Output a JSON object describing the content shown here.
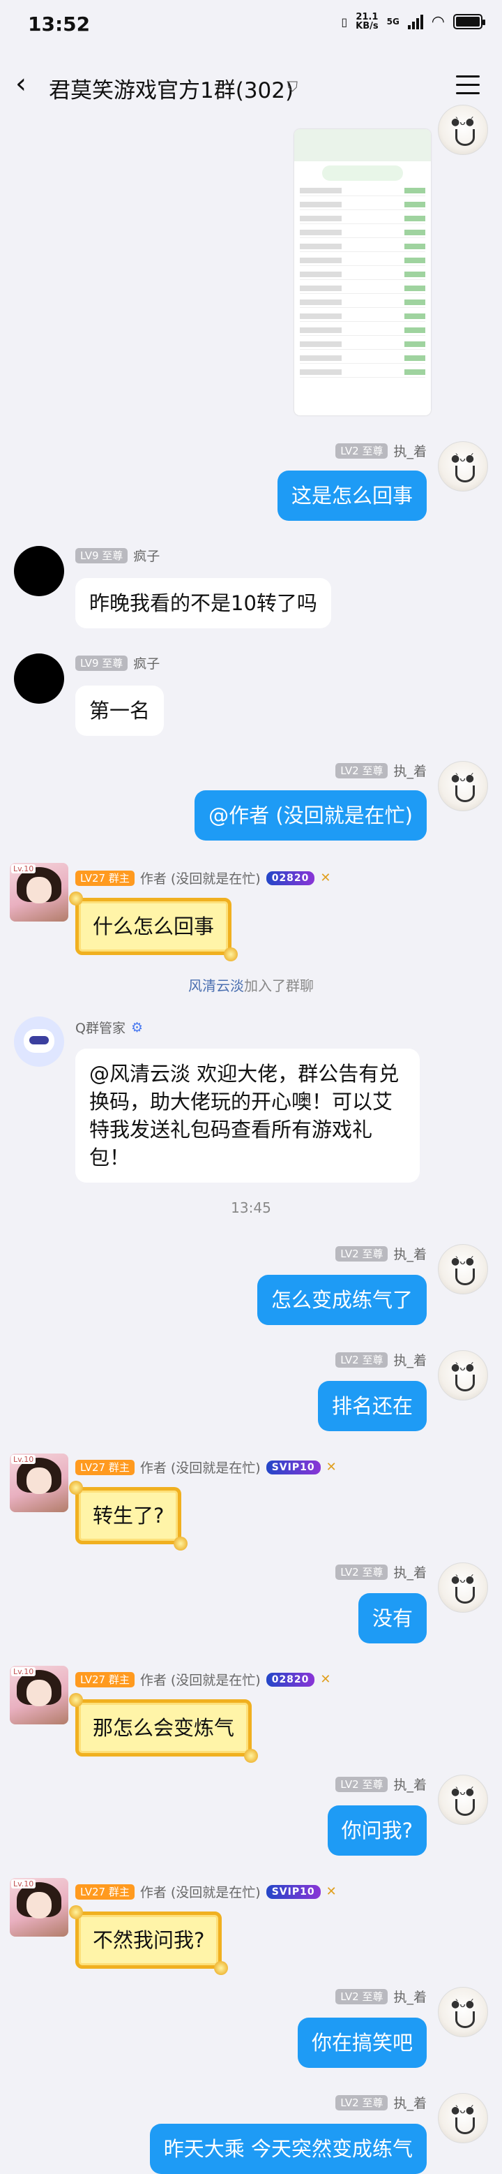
{
  "status": {
    "time": "13:52",
    "net_speed": "21.1",
    "net_unit": "KB/s",
    "net_type": "5G"
  },
  "header": {
    "title": "君莫笑游戏官方1群(302)"
  },
  "users": {
    "self": {
      "level": "LV2 至尊",
      "name": "执_着"
    },
    "fengzi": {
      "level": "LV9 至尊",
      "name": "疯子"
    },
    "author": {
      "level": "LV27 群主",
      "name": "作者 (没回就是在忙)",
      "vip": "SVIP10",
      "avatar_level": "Lv.10"
    },
    "author2": {
      "vip": "02820"
    },
    "bot": {
      "name": "Q群管家"
    }
  },
  "messages": {
    "m1": "这是怎么回事",
    "m2": "昨晚我看的不是10转了吗",
    "m3": "第一名",
    "m4": "@作者 (没回就是在忙)",
    "m5": "什么怎么回事",
    "join_name": "风清云淡",
    "join_suffix": "加入了群聊",
    "m6": "@风清云淡 欢迎大佬，群公告有兑换码，助大佬玩的开心噢！可以艾特我发送礼包码查看所有游戏礼包！",
    "time_divider": "13:45",
    "m7": "怎么变成练气了",
    "m8": "排名还在",
    "m9": "转生了?",
    "m10": "没有",
    "m11": "那怎么会变炼气",
    "m12": "你问我?",
    "m13": "不然我问我?",
    "m14": "你在搞笑吧",
    "m15": "昨天大乘 今天突然变成练气"
  }
}
